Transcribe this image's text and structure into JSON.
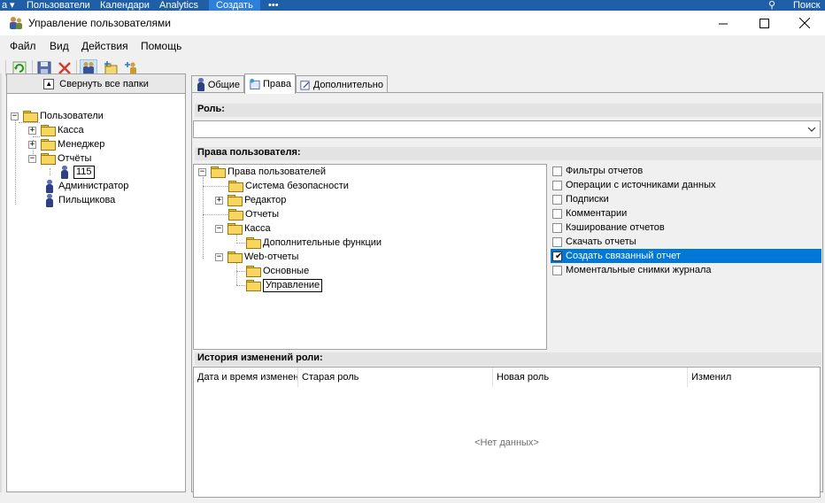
{
  "taskbar": {
    "items": [
      "a",
      "Пользователи",
      "Календари",
      "Analytics",
      "Создать",
      "•••",
      "Поиск"
    ]
  },
  "window": {
    "title": "Управление пользователями",
    "controls": {
      "minimize": "—",
      "maximize": "☐",
      "close": "✕"
    }
  },
  "menu": [
    "Файл",
    "Вид",
    "Действия",
    "Помощь"
  ],
  "toolbar": {
    "icons": [
      "refresh-icon",
      "save-icon",
      "delete-icon",
      "users-icon",
      "add-group-icon",
      "add-user-icon"
    ]
  },
  "left_tree": {
    "collapse_label": "Свернуть все папки",
    "nodes": [
      {
        "label": "Пользователи",
        "kind": "folder",
        "expander": "−"
      },
      {
        "label": "Касса",
        "kind": "folder",
        "expander": "+"
      },
      {
        "label": "Менеджер",
        "kind": "folder",
        "expander": "+"
      },
      {
        "label": "Отчёты",
        "kind": "folder",
        "expander": "−"
      },
      {
        "label": "115",
        "kind": "user"
      },
      {
        "label": "Администратор",
        "kind": "user"
      },
      {
        "label": "Пильщикова",
        "kind": "user"
      }
    ]
  },
  "tabs": [
    {
      "label": "Общие",
      "icon": "user-icon"
    },
    {
      "label": "Права",
      "icon": "rights-icon",
      "active": true
    },
    {
      "label": "Дополнительно",
      "icon": "edit-icon"
    }
  ],
  "role": {
    "label": "Роль:",
    "value": ""
  },
  "rights": {
    "label": "Права пользователя:",
    "tree": [
      {
        "label": "Права пользователей",
        "expander": "−"
      },
      {
        "label": "Система безопасности"
      },
      {
        "label": "Редактор",
        "expander": "+"
      },
      {
        "label": "Отчеты"
      },
      {
        "label": "Касса",
        "expander": "−"
      },
      {
        "label": "Дополнительные функции"
      },
      {
        "label": "Web-отчеты",
        "expander": "−"
      },
      {
        "label": "Основные"
      },
      {
        "label": "Управление",
        "selected": true
      }
    ],
    "permissions": [
      {
        "label": "Фильтры отчетов",
        "checked": false
      },
      {
        "label": "Операции с источниками данных",
        "checked": false
      },
      {
        "label": "Подписки",
        "checked": false
      },
      {
        "label": "Комментарии",
        "checked": false
      },
      {
        "label": "Кэширование отчетов",
        "checked": false
      },
      {
        "label": "Скачать отчеты",
        "checked": false
      },
      {
        "label": "Создать связанный отчет",
        "checked": true,
        "selected": true
      },
      {
        "label": "Моментальные снимки журнала",
        "checked": false
      }
    ]
  },
  "history": {
    "label": "История изменений роли:",
    "columns": [
      "Дата и время изменен",
      "Старая роль",
      "Новая роль",
      "Изменил"
    ],
    "empty_text": "<Нет данных>"
  },
  "colors": {
    "taskbar": "#1f5fa8",
    "selection": "#0078d7",
    "folder": "#f7d660"
  }
}
